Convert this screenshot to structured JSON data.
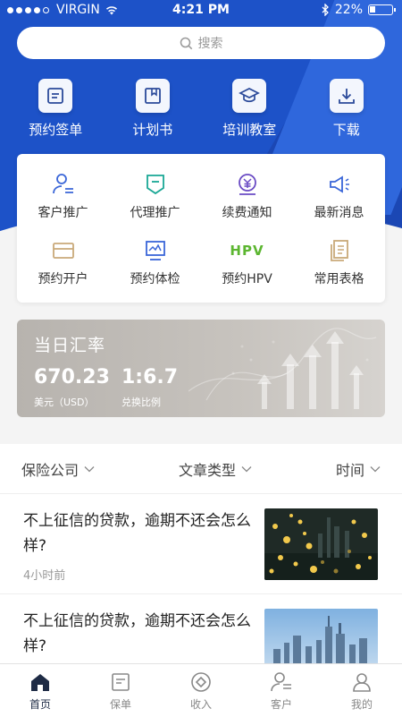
{
  "status": {
    "carrier": "VIRGIN",
    "time": "4:21 PM",
    "battery": "22%",
    "battery_level": 0.22
  },
  "search": {
    "placeholder": "搜索",
    "icon": "search-icon"
  },
  "quick_actions": [
    {
      "label": "预约签单",
      "icon": "document-icon"
    },
    {
      "label": "计划书",
      "icon": "book-icon"
    },
    {
      "label": "培训教室",
      "icon": "graduation-cap-icon"
    },
    {
      "label": "下载",
      "icon": "download-icon"
    }
  ],
  "features": [
    {
      "label": "客户推广",
      "icon": "user-list-icon",
      "color": "#3a66d8"
    },
    {
      "label": "代理推广",
      "icon": "tag-icon",
      "color": "#19a795"
    },
    {
      "label": "续费通知",
      "icon": "yuan-icon",
      "color": "#6a4bc4"
    },
    {
      "label": "最新消息",
      "icon": "megaphone-icon",
      "color": "#3a66d8"
    },
    {
      "label": "预约开户",
      "icon": "card-icon",
      "color": "#c9a979"
    },
    {
      "label": "预约体检",
      "icon": "monitor-icon",
      "color": "#3a66d8"
    },
    {
      "label": "预约HPV",
      "icon": "hpv-icon",
      "color": "#5cb631",
      "icon_text": "HPV"
    },
    {
      "label": "常用表格",
      "icon": "forms-icon",
      "color": "#c9a979"
    }
  ],
  "rate": {
    "title": "当日汇率",
    "value1": "670.23",
    "label1": "美元（USD）",
    "value2": "1:6.7",
    "label2": "兑换比例"
  },
  "filters": [
    {
      "label": "保险公司"
    },
    {
      "label": "文章类型"
    },
    {
      "label": "时间"
    }
  ],
  "articles": [
    {
      "title": "不上征信的贷款，逾期不还会怎么样?",
      "meta": "4小时前",
      "image": "night-city-bokeh"
    },
    {
      "title": "不上征信的贷款，逾期不还会怎么样?",
      "meta": "",
      "image": "city-skyline"
    }
  ],
  "tabs": [
    {
      "label": "首页",
      "icon": "home-icon",
      "active": true
    },
    {
      "label": "保单",
      "icon": "policy-icon",
      "active": false
    },
    {
      "label": "收入",
      "icon": "income-icon",
      "active": false
    },
    {
      "label": "客户",
      "icon": "customer-icon",
      "active": false
    },
    {
      "label": "我的",
      "icon": "profile-icon",
      "active": false
    }
  ]
}
